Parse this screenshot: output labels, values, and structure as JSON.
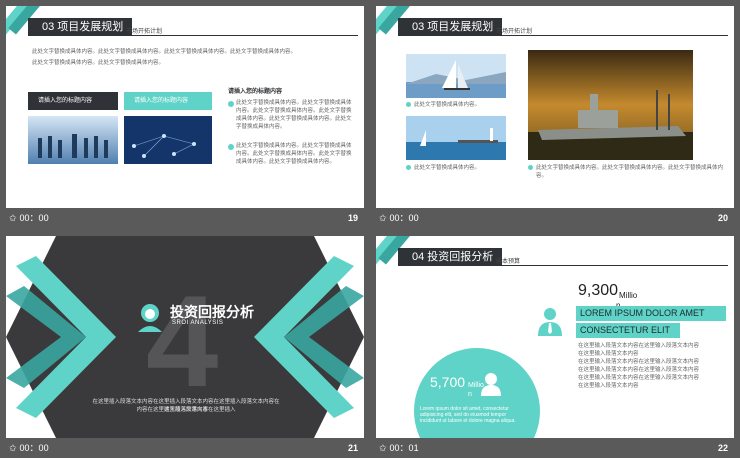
{
  "slides": [
    {
      "title": "03 项目发展规划",
      "subtitle": "市场开拓计划",
      "intro": [
        "此处文字替换成具体内容。此处文字替换成具体内容。此处文字替换成具体内容。此处文字替换成具体内容。",
        "此处文字替换成具体内容。此处文字替换成具体内容。"
      ],
      "box1": "请插入您的标题内容",
      "box2": "请插入您的标题内容",
      "right_title": "请插入您的标题内容",
      "right_p1": "此处文字替换成具体内容。此处文字替换成具体内容。此处文字替换成具体内容。此处文字替换成具体内容。此处文字替换成具体内容。此处文字替换成具体内容。",
      "right_p2": "此处文字替换成具体内容。此处文字替换成具体内容。此处文字替换成具体内容。此处文字替换成具体内容。此处文字替换成具体内容。",
      "time": "00：00",
      "num": "19"
    },
    {
      "title": "03 项目发展规划",
      "subtitle": "市场开拓计划",
      "cap1": "此处文字替换成具体内容。",
      "cap2": "此处文字替换成具体内容。此处文字替换成具体内容。此处文字替换成具体内容。",
      "time": "00：00",
      "num": "20"
    },
    {
      "big_digit": "4",
      "title": "投资回报分析",
      "en": "SROI ANALYSIS",
      "desc1": "在这里插入段落文本内容在这里插入段落文本内容在这里插入段落文本内容在这里插入段落文本",
      "desc2": "内容在这里插入段落文本内容在这里插入",
      "time": "00：00",
      "num": "21"
    },
    {
      "title": "04 投资回报分析",
      "subtitle": "成本预算",
      "top_value": "9,300",
      "top_unit": "Millio",
      "top_unit2": "n",
      "heading1": "LOREM IPSUM DOLOR AMET",
      "heading2": "CONSECTETUR ELIT",
      "lines": [
        "在这里输入段落文本内容在这里输入段落文本内容",
        "在这里输入段落文本内容",
        "在这里输入段落文本内容在这里输入段落文本内容",
        "在这里输入段落文本内容在这里输入段落文本内容",
        "在这里输入段落文本内容在这里输入段落文本内容",
        "在这里输入段落文本内容"
      ],
      "circle_value": "5,700",
      "circle_unit": "Millio",
      "circle_unit2": "n",
      "circle_text": "Lorem ipsum dolor sit amet, consectetur adipisicing elit, sed do eiusmod tempor incididunt ut labore et dolore magna aliqua.",
      "time": "00：01",
      "num": "22"
    }
  ],
  "colors": {
    "accent": "#5fd3c7",
    "dark": "#2f3236",
    "bg": "#5a5a5a"
  }
}
